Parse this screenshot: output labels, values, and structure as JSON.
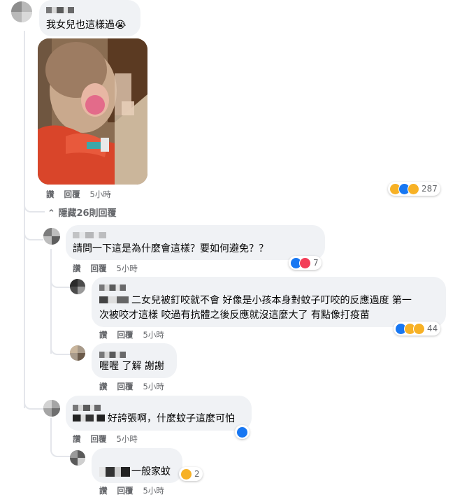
{
  "comments": [
    {
      "text": "我女兒也這樣過",
      "emoji": "😭",
      "has_photo": true,
      "actions": {
        "like": "讚",
        "reply": "回覆",
        "time": "5小時"
      },
      "reactions": {
        "icons": [
          "wow-icon",
          "like-icon",
          "sad-icon"
        ],
        "count": "287"
      }
    },
    {
      "text": "請問一下這是為什麼會這樣？要如何避免？？",
      "actions": {
        "like": "讚",
        "reply": "回覆",
        "time": "5小時"
      },
      "reactions": {
        "icons": [
          "like-icon",
          "love-icon"
        ],
        "count": "7"
      }
    },
    {
      "text_line1": "二女兒被釘咬就不會 好像是小孩本身對蚊子叮咬的反應過度 第一",
      "text_line2": "次被咬才這樣 咬過有抗體之後反應就沒這麼大了 有點像打疫苗",
      "actions": {
        "like": "讚",
        "reply": "回覆",
        "time": "5小時"
      },
      "reactions": {
        "icons": [
          "like-icon",
          "care-icon",
          "wow-icon"
        ],
        "count": "44"
      }
    },
    {
      "text": "喔喔 了解 謝謝",
      "actions": {
        "like": "讚",
        "reply": "回覆",
        "time": "5小時"
      }
    },
    {
      "text": "好誇張啊，什麼蚊子這麼可怕",
      "actions": {
        "like": "讚",
        "reply": "回覆",
        "time": "5小時"
      },
      "reactions": {
        "icons": [
          "like-icon"
        ],
        "count": ""
      }
    },
    {
      "text": "一般家蚊",
      "actions": {
        "like": "讚",
        "reply": "回覆",
        "time": "5小時"
      },
      "reactions": {
        "icons": [
          "wow-icon"
        ],
        "count": "2"
      }
    }
  ],
  "hidden_replies": {
    "label": "隱藏26則回覆",
    "chevron": "chevron-up-icon"
  },
  "colors": {
    "bubble": "#f0f2f5",
    "meta": "#65676b",
    "like": "#1877f2",
    "love": "#f33e58",
    "wow": "#f7b125"
  }
}
